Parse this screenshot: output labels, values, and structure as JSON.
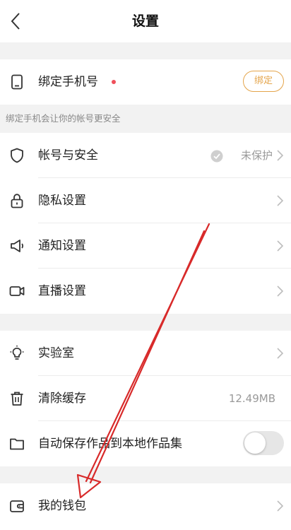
{
  "header": {
    "title": "设置"
  },
  "phone_bind": {
    "label": "绑定手机号",
    "button_label": "绑定"
  },
  "hint_text": "绑定手机会让你的帐号更安全",
  "group1": [
    {
      "label": "帐号与安全",
      "status": "未保护"
    },
    {
      "label": "隐私设置"
    },
    {
      "label": "通知设置"
    },
    {
      "label": "直播设置"
    }
  ],
  "group2": [
    {
      "label": "实验室"
    },
    {
      "label": "清除缓存",
      "value": "12.49MB"
    },
    {
      "label": "自动保存作品到本地作品集",
      "toggle_on": false
    }
  ],
  "group3": [
    {
      "label": "我的钱包"
    }
  ],
  "colors": {
    "accent": "#e4a44a",
    "dot": "#ef4f5a",
    "annotation": "#d82a2a"
  },
  "icons": [
    "back-arrow-icon",
    "phone-icon",
    "shield-icon",
    "lock-icon",
    "megaphone-icon",
    "camera-icon",
    "bulb-icon",
    "trash-icon",
    "folder-icon",
    "wallet-icon",
    "chevron-right-icon",
    "check-circle-icon"
  ]
}
